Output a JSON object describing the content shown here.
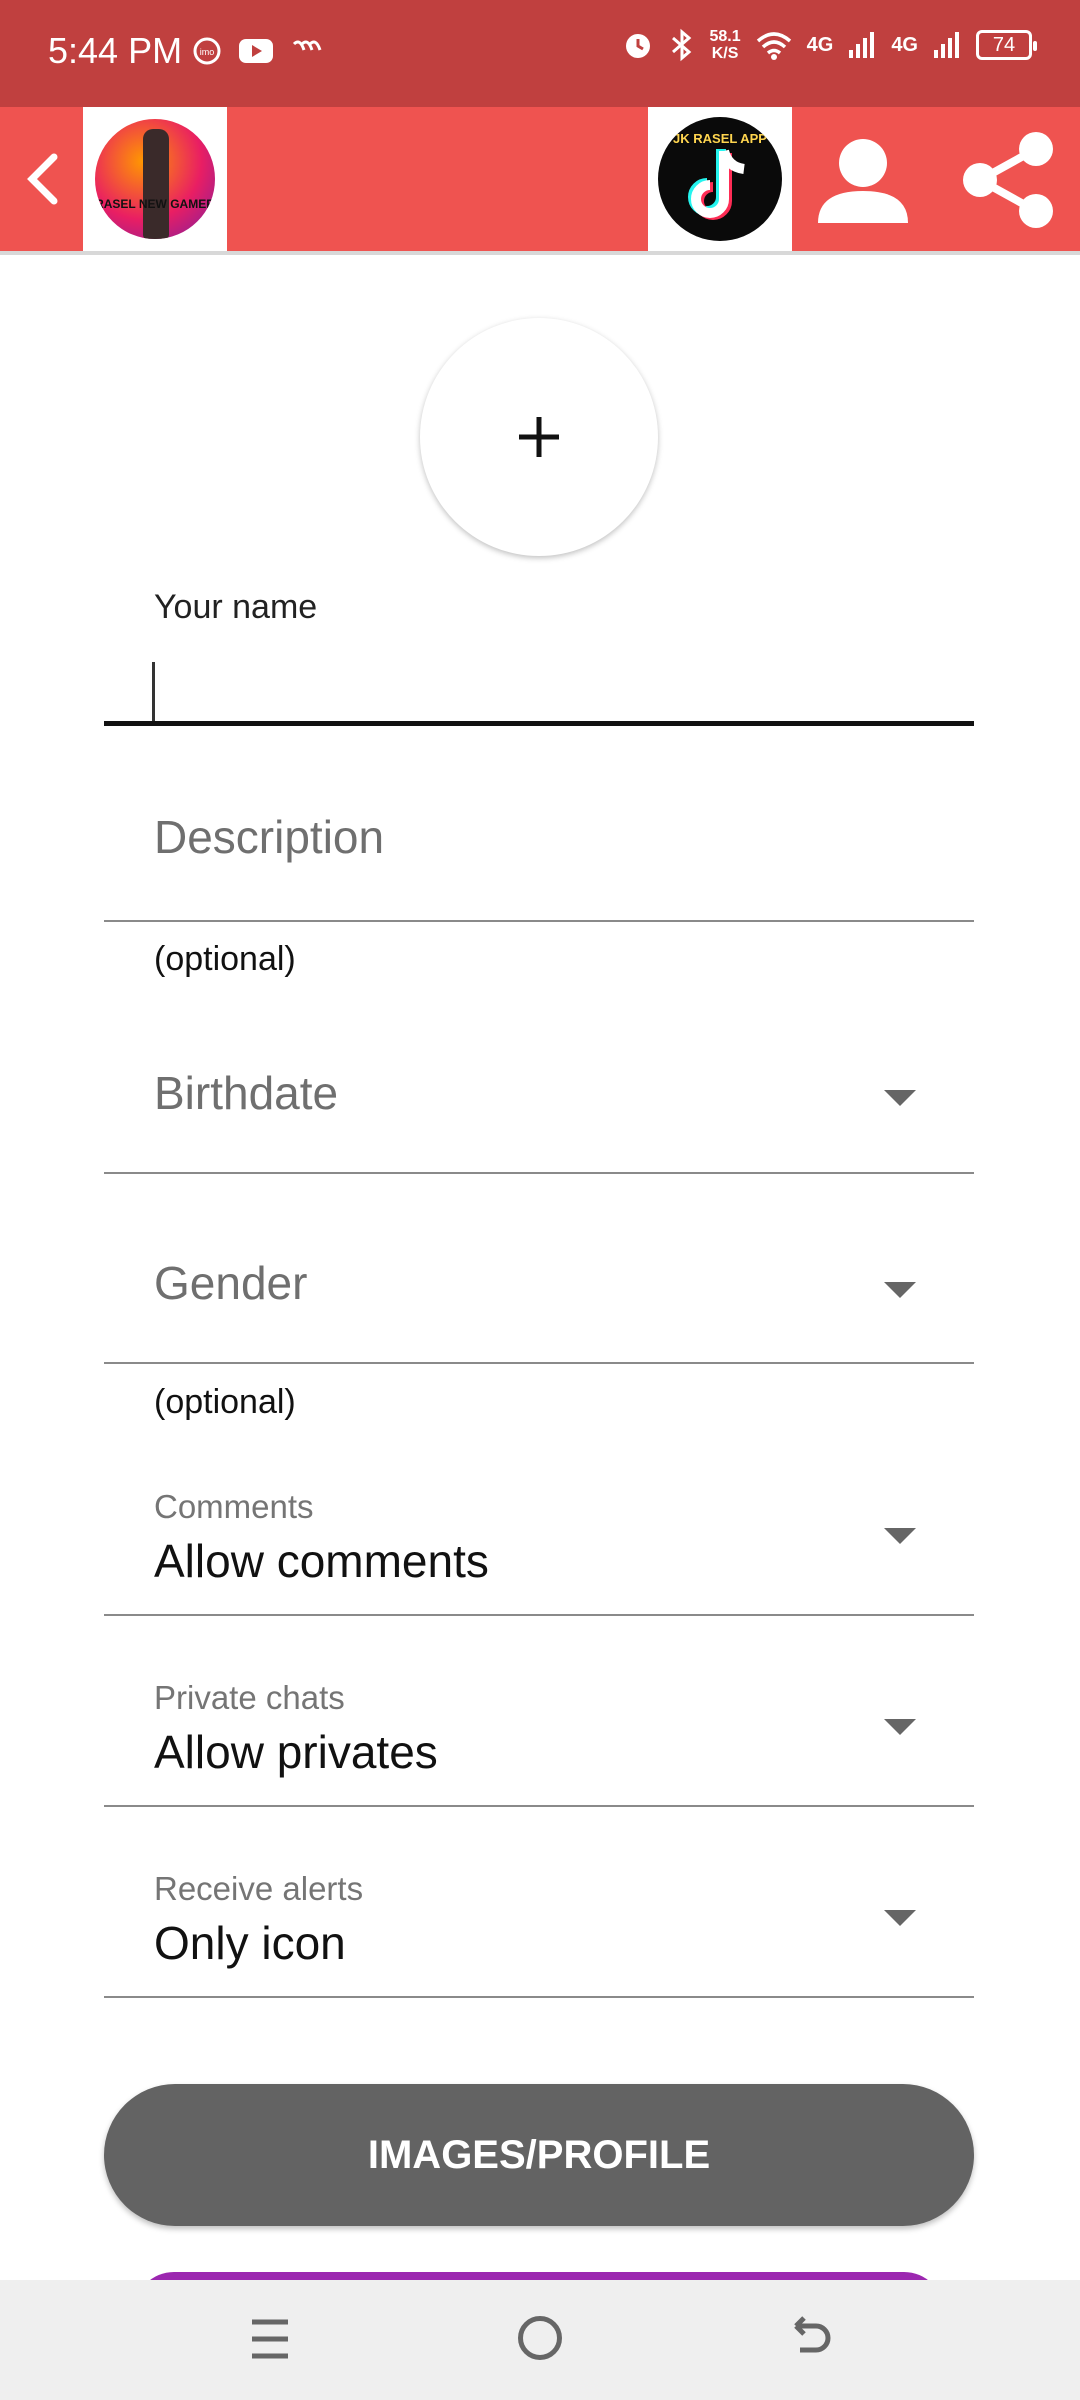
{
  "status_bar": {
    "time": "5:44 PM",
    "speed_value": "58.1",
    "speed_unit": "K/S",
    "network_1": "4G",
    "network_2": "4G",
    "battery": "74"
  },
  "header": {
    "left_avatar_text": "RASEL NEW GAMER",
    "right_avatar_text": "JK RASEL APP",
    "icons": [
      "chevron-left-icon",
      "user-icon",
      "share-icon"
    ]
  },
  "form": {
    "add_photo_icon": "plus-icon",
    "name_label": "Your name",
    "name_value": "",
    "description_placeholder": "Description",
    "description_helper": "(optional)",
    "birthdate_placeholder": "Birthdate",
    "gender_placeholder": "Gender",
    "gender_helper": "(optional)",
    "comments_label": "Comments",
    "comments_value": "Allow comments",
    "private_label": "Private chats",
    "private_value": "Allow privates",
    "alerts_label": "Receive alerts",
    "alerts_value": "Only icon"
  },
  "buttons": {
    "images_profile": "IMAGES/PROFILE"
  },
  "colors": {
    "status_bar": "#c0403f",
    "app_bar": "#ef5350",
    "primary_button": "#636363",
    "accent_button": "#9c27b0"
  }
}
